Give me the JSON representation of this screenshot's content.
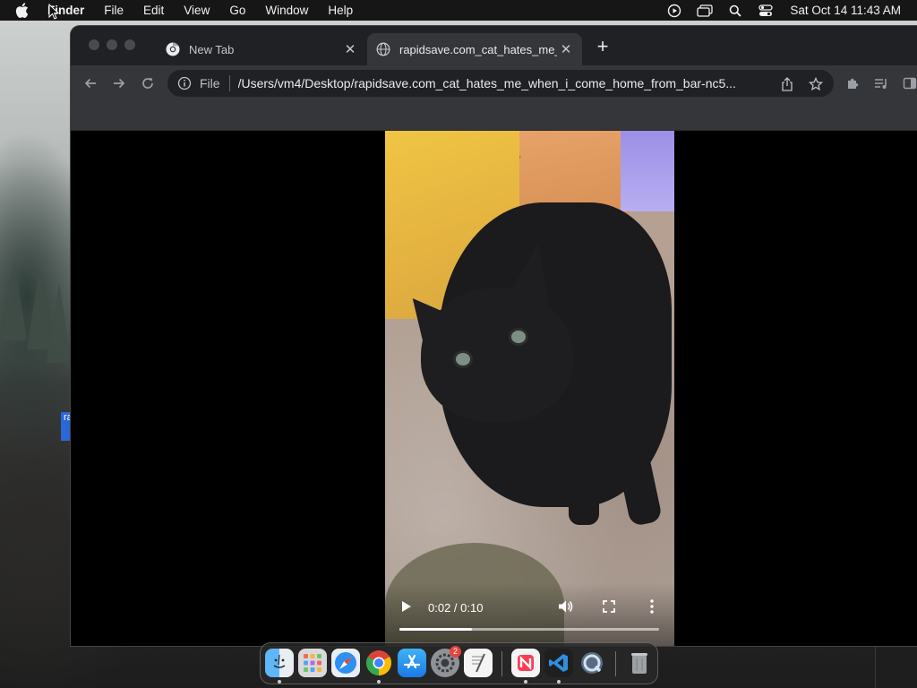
{
  "menubar": {
    "app_name": "Finder",
    "items": [
      "File",
      "Edit",
      "View",
      "Go",
      "Window",
      "Help"
    ],
    "clock": "Sat Oct 14  11:43 AM",
    "status_icons": [
      "play-circle-icon",
      "window-icon",
      "search-icon",
      "control-center-icon"
    ]
  },
  "browser": {
    "tabs": [
      {
        "title": "New Tab",
        "icon": "chrome-icon",
        "active": false
      },
      {
        "title": "rapidsave.com_cat_hates_me_when_i_come_home_from_bar",
        "icon": "globe-icon",
        "active": true
      }
    ],
    "omnibox": {
      "scheme": "File",
      "url": "/Users/vm4/Desktop/rapidsave.com_cat_hates_me_when_i_come_home_from_bar-nc5..."
    }
  },
  "video": {
    "time": "0:02 / 0:10",
    "progress": 0.28
  },
  "desktop": {
    "file_label": "ra"
  },
  "dock": {
    "apps": [
      "finder-icon",
      "launchpad-icon",
      "safari-icon",
      "chrome-icon",
      "app-store-icon",
      "system-settings-icon",
      "textedit-icon",
      "news-icon",
      "vscode-icon",
      "quicktime-icon",
      "trash-icon"
    ],
    "settings_badge": "2"
  },
  "colors": {
    "menubar_bg": "#161616",
    "tabstrip_bg": "#202124",
    "toolbar_bg": "#35363a",
    "omnibox_bg": "#202124"
  }
}
